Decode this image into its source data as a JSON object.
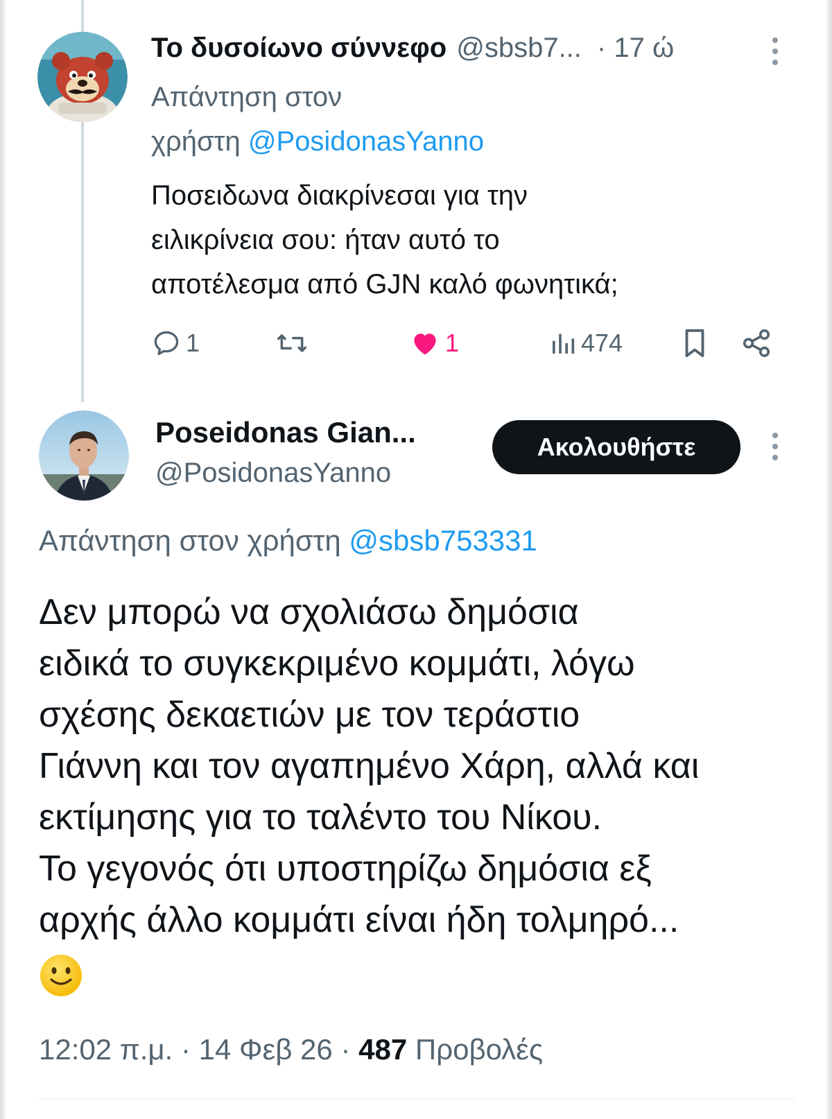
{
  "colors": {
    "text_primary": "#0f1419",
    "text_secondary": "#536471",
    "link": "#1d9bf0",
    "like": "#f91880",
    "follow_button_bg": "#0f1419"
  },
  "tweet1": {
    "display_name": "Το δυσοίωνο σύννεφο",
    "handle": "@sbsb7...",
    "time": "· 17 ώ",
    "reply_to_prefix_line1": "Απάντηση στον",
    "reply_to_prefix_line2": "χρήστη",
    "reply_to_handle": "@PosidonasYanno",
    "text_lines": [
      "Ποσειδωνα διακρίνεσαι για την",
      "ειλικρίνεια σου: ήταν αυτό το",
      "αποτέλεσμα από GJN καλό φωνητικά;"
    ],
    "actions": {
      "replies": "1",
      "likes": "1",
      "views": "474"
    },
    "icons": [
      "reply-icon",
      "retweet-icon",
      "like-icon",
      "views-icon",
      "bookmark-icon",
      "share-icon",
      "more-icon"
    ]
  },
  "tweet2": {
    "display_name": "Poseidonas Gian...",
    "handle": "@PosidonasYanno",
    "follow_label": "Ακολουθήστε",
    "reply_to_prefix": "Απάντηση στον χρήστη",
    "reply_to_handle": "@sbsb753331",
    "text_lines": [
      "Δεν μπορώ να σχολιάσω δημόσια",
      "ειδικά το συγκεκριμένο κομμάτι, λόγω",
      "σχέσης δεκαετιών με τον τεράστιο",
      "Γιάννη και τον αγαπημένο Χάρη, αλλά και",
      "εκτίμησης για το ταλέντο του Νίκου.",
      "Το γεγονός ότι υποστηρίζω δημόσια εξ",
      "αρχής άλλο κομμάτι είναι ήδη τολμηρό..."
    ],
    "emoji": "slightly-smiling-face-icon",
    "timestamp": "12:02 π.μ. · 14 Φεβ 26 · ",
    "views_count": "487",
    "views_label": " Προβολές"
  }
}
